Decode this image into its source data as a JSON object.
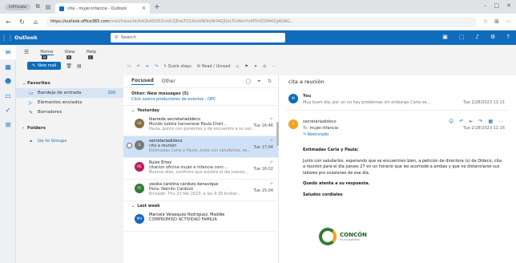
{
  "browser": {
    "inprivate_label": "InPrivate",
    "tab_title": "cita - mujer.infancia - Outlook",
    "url_host": "https://outlook.office365.com",
    "url_rest": "/mail/inbox/id/AAQkADQ5ZmVkZjEwLTQ1NzUtNDhjNi04ZjQxLTUzNmYxMTk0ZDM4ZgAQAG..."
  },
  "outlook": {
    "brand": "Outlook",
    "search_placeholder": "Search"
  },
  "ribbon": {
    "tabs": [
      {
        "label": "Home",
        "key": "H"
      },
      {
        "label": "View",
        "key": "V"
      },
      {
        "label": "Help",
        "key": "L"
      }
    ],
    "new_mail": "New mail",
    "quick_steps": "Quick steps",
    "read_unread": "Read / Unread"
  },
  "folders": {
    "favorites": "Favorites",
    "inbox": "Bandeja de entrada",
    "inbox_count": "200",
    "sent": "Elementos enviados",
    "drafts": "Borradores",
    "folders_label": "Folders",
    "go_to_groups": "Go to Groups"
  },
  "list": {
    "tab_focused": "Focused",
    "tab_other": "Other",
    "other_title": "Other: New messages (5)",
    "other_link": "Click Lexico productores de eventos · OPC",
    "group_yesterday": "Yesterday",
    "group_last_week": "Last week",
    "messages": [
      {
        "sender": "lbarreda secretariadideco",
        "subject": "Mundo ludota hansenese Paula Chell...",
        "preview": "Paula, punto con ponentes y de encuentro a su ver...",
        "time": "Tue 16:46",
        "initials": "LS",
        "color": "#8a6d3b"
      },
      {
        "sender": "secretariadideco",
        "subject": "cita a reunión",
        "preview": "Estimadas Carla y Paula: Justo con saludarlos, es...",
        "time": "Tue 17:04",
        "initials": "S",
        "color": "#7a7a7a"
      },
      {
        "sender": "Ruizo Ertez",
        "subject": "citacion oficina mujer e infancia conc...",
        "preview": "Buenos días, confirmo que asistiré el día jueves...",
        "time": "Tue 16:02",
        "initials": "RE",
        "color": "#c2185b"
      },
      {
        "sender": "yesika carolina cardozo benavique",
        "subject": "Hora: Nainito Cardozo",
        "preview": "Enviado: Thu 23 feb 2023, a las 9:35 Invitar...",
        "time": "Tue 15:04",
        "initials": "YC",
        "color": "#2e7d32"
      },
      {
        "sender": "Marcela Velasquez Rodriguez, Maddie",
        "subject": "COMPROMISO ACTIVIDAD FAMILIA",
        "preview": "",
        "time": "",
        "initials": "MV",
        "color": "#1565c0"
      }
    ]
  },
  "reading": {
    "subject": "cita a reunión",
    "m1_from": "You",
    "m1_preview": "Muy buen día, por un no hay problemas sin embargo Carla se...",
    "m1_date": "Tue 2/28/2023 11:11",
    "m2_from": "secretariadideco",
    "m2_to_label": "To:",
    "m2_to": "mujer.infancia",
    "m2_forwarded": "Reenviado",
    "m2_date": "Tue 2/28/2023 11:16",
    "body": [
      "Estimadas Carla y Paula:",
      "Junto con saludarlos, esperando que se encuentren bien, a petición de directora (s) de Dideco, cita a reunión para el día jueves 27 en un horario que les acomode a ambas y que no distanciarse sus labores pro ocasiones de ese día.",
      "Quedo atenta a su respuesta.",
      "Saludos cordiales"
    ],
    "logo_text": "CONCÓN",
    "logo_sub": "municipalidad"
  }
}
